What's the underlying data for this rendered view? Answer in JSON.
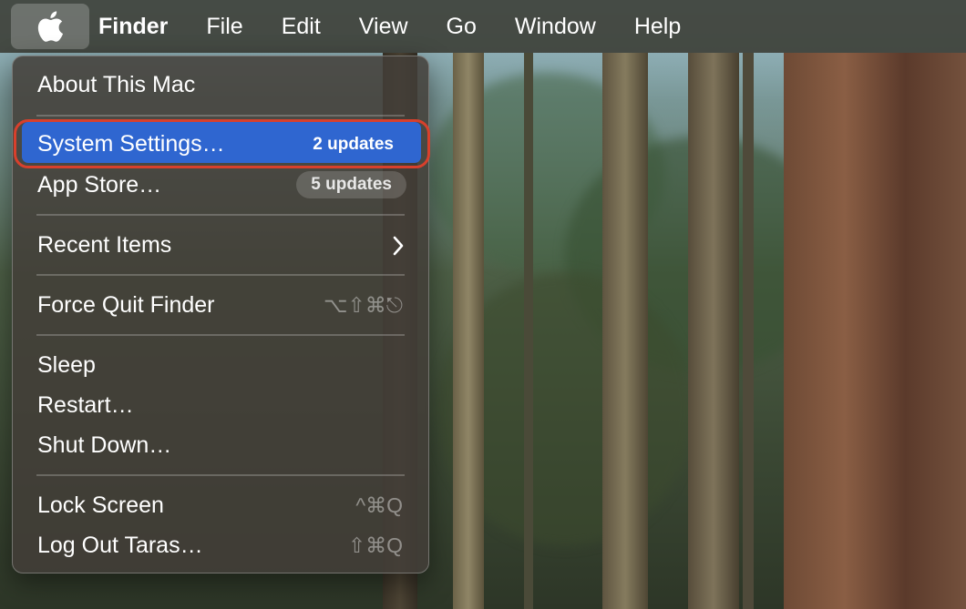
{
  "menubar": {
    "apple_icon": "apple-logo-icon",
    "items": [
      "Finder",
      "File",
      "Edit",
      "View",
      "Go",
      "Window",
      "Help"
    ]
  },
  "apple_menu": {
    "about": "About This Mac",
    "system_settings": {
      "label": "System Settings…",
      "badge": "2 updates"
    },
    "app_store": {
      "label": "App Store…",
      "badge": "5 updates"
    },
    "recent_items": {
      "label": "Recent Items",
      "icon": "chevron-right-icon"
    },
    "force_quit": {
      "label": "Force Quit Finder",
      "shortcut": "⌥⇧⌘⎋"
    },
    "sleep": "Sleep",
    "restart": "Restart…",
    "shut_down": "Shut Down…",
    "lock_screen": {
      "label": "Lock Screen",
      "shortcut": "^⌘Q"
    },
    "log_out": {
      "label": "Log Out Taras…",
      "shortcut": "⇧⌘Q"
    }
  },
  "colors": {
    "highlight": "#2f66d0",
    "annotation_ring": "#d8402c"
  }
}
